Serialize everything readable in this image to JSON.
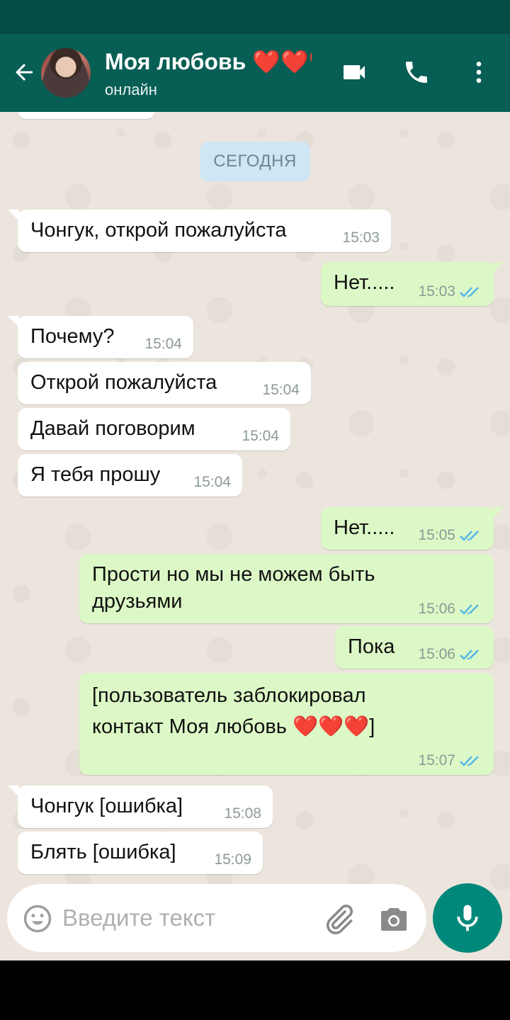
{
  "header": {
    "contact_name": "Моя любовь ❤️❤️❤️",
    "status": "онлайн"
  },
  "chat": {
    "date_chip": "СЕГОДНЯ",
    "messages": [
      {
        "dir": "in",
        "text": "Чонгук, открой пожалуйста",
        "time": "15:03"
      },
      {
        "dir": "out",
        "text": "Нет.....",
        "time": "15:03",
        "read": true
      },
      {
        "dir": "in",
        "text": "Почему?",
        "time": "15:04"
      },
      {
        "dir": "in",
        "text": "Открой пожалуйста",
        "time": "15:04"
      },
      {
        "dir": "in",
        "text": "Давай поговорим",
        "time": "15:04"
      },
      {
        "dir": "in",
        "text": "Я тебя прошу",
        "time": "15:04"
      },
      {
        "dir": "out",
        "text": "Нет.....",
        "time": "15:05",
        "read": true
      },
      {
        "dir": "out",
        "text": "Прости но мы не можем быть\nдрузьями",
        "time": "15:06",
        "read": true
      },
      {
        "dir": "out",
        "text": "Пока",
        "time": "15:06",
        "read": true
      },
      {
        "dir": "out",
        "text": "[пользователь заблокировал\nконтакт Моя любовь ❤️❤️❤️]",
        "time": "15:07",
        "read": true
      },
      {
        "dir": "in",
        "text": "Чонгук [ошибка]",
        "time": "15:08"
      },
      {
        "dir": "in",
        "text": "Блять [ошибка]",
        "time": "15:09"
      }
    ]
  },
  "input": {
    "placeholder": "Введите текст",
    "value": ""
  },
  "icons": {
    "back": "arrow-left-icon",
    "video": "video-camera-icon",
    "call": "phone-icon",
    "menu": "more-vertical-icon",
    "emoji": "smiley-icon",
    "attach": "paperclip-icon",
    "camera": "camera-icon",
    "mic": "microphone-icon"
  },
  "colors": {
    "header": "#075e54",
    "status_bar": "#054d44",
    "outgoing_bubble": "#dcf8c6",
    "incoming_bubble": "#ffffff",
    "chat_background": "#ece5dd",
    "read_ticks": "#4fb6ec",
    "mic_button": "#00897b"
  }
}
